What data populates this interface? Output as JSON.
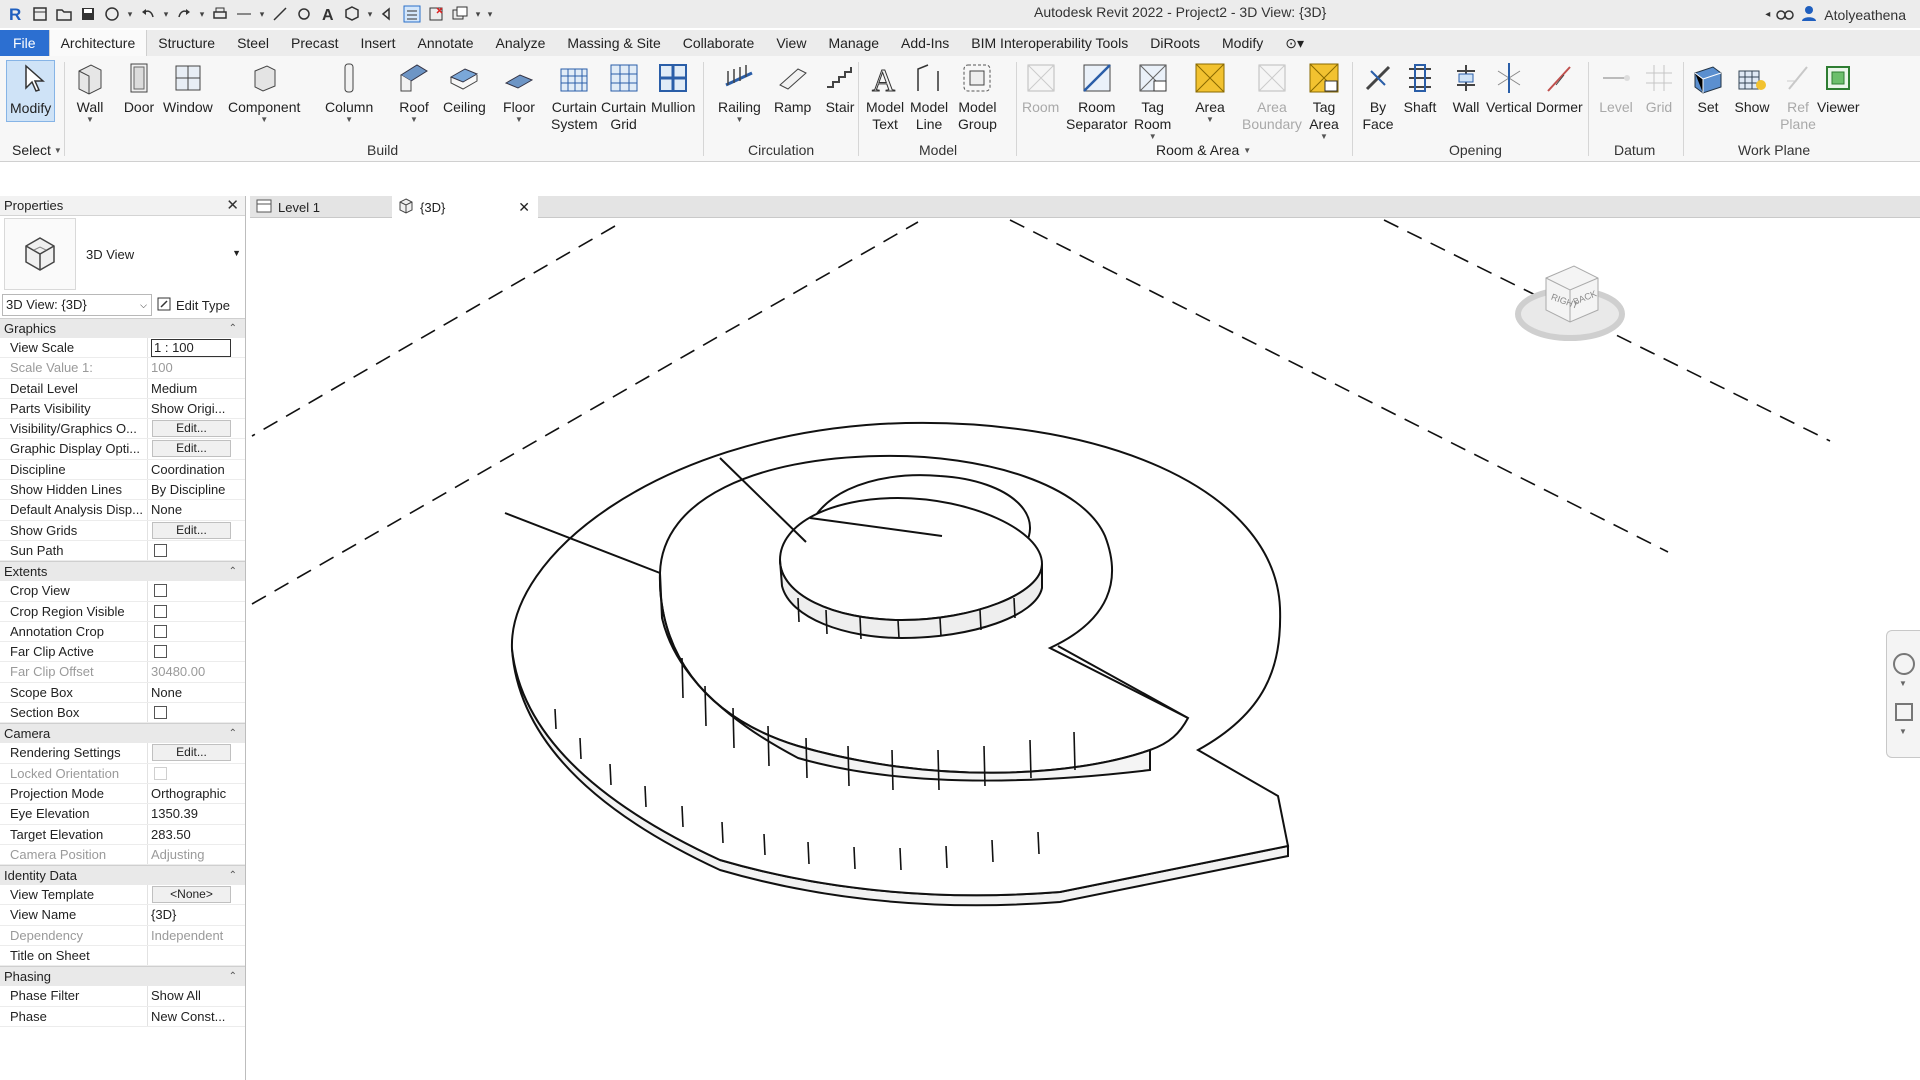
{
  "titlebar": {
    "title": "Autodesk Revit 2022 - Project2 - 3D View: {3D}",
    "user": "Atolyeathena",
    "app_icon": "R"
  },
  "menu": {
    "tabs": [
      "File",
      "Architecture",
      "Structure",
      "Steel",
      "Precast",
      "Insert",
      "Annotate",
      "Analyze",
      "Massing & Site",
      "Collaborate",
      "View",
      "Manage",
      "Add-Ins",
      "BIM Interoperability Tools",
      "DiRoots",
      "Modify"
    ],
    "active": "Architecture"
  },
  "ribbon": {
    "buttons": {
      "modify": "Modify",
      "wall": "Wall",
      "door": "Door",
      "window": "Window",
      "component": "Component",
      "column": "Column",
      "roof": "Roof",
      "ceiling": "Ceiling",
      "floor": "Floor",
      "curtain_system_1": "Curtain",
      "curtain_system_2": "System",
      "curtain_grid_1": "Curtain",
      "curtain_grid_2": "Grid",
      "mullion": "Mullion",
      "railing": "Railing",
      "ramp": "Ramp",
      "stair": "Stair",
      "model_text_1": "Model",
      "model_text_2": "Text",
      "model_line_1": "Model",
      "model_line_2": "Line",
      "model_group_1": "Model",
      "model_group_2": "Group",
      "room": "Room",
      "room_sep_1": "Room",
      "room_sep_2": "Separator",
      "tag_room_1": "Tag",
      "tag_room_2": "Room",
      "area": "Area",
      "area_boundary_1": "Area",
      "area_boundary_2": "Boundary",
      "tag_area_1": "Tag",
      "tag_area_2": "Area",
      "by_face_1": "By",
      "by_face_2": "Face",
      "shaft": "Shaft",
      "opening_wall": "Wall",
      "vertical": "Vertical",
      "dormer": "Dormer",
      "level": "Level",
      "grid": "Grid",
      "set": "Set",
      "show": "Show",
      "ref_plane_1": "Ref",
      "ref_plane_2": "Plane",
      "viewer": "Viewer"
    },
    "panels": {
      "select": "Select",
      "build": "Build",
      "circulation": "Circulation",
      "model": "Model",
      "room_area": "Room & Area",
      "opening": "Opening",
      "datum": "Datum",
      "work_plane": "Work Plane"
    }
  },
  "properties": {
    "header": "Properties",
    "type_name": "3D View",
    "instance": "3D View: {3D}",
    "edit_type": "Edit Type",
    "sections": {
      "graphics": "Graphics",
      "extents": "Extents",
      "camera": "Camera",
      "identity": "Identity Data",
      "phasing": "Phasing"
    },
    "rows": {
      "view_scale": {
        "name": "View Scale",
        "value": "1 : 100"
      },
      "scale_value": {
        "name": "Scale Value    1:",
        "value": "100"
      },
      "detail_level": {
        "name": "Detail Level",
        "value": "Medium"
      },
      "parts_visibility": {
        "name": "Parts Visibility",
        "value": "Show Origi..."
      },
      "vg_overrides": {
        "name": "Visibility/Graphics O...",
        "value": "Edit..."
      },
      "graphic_display": {
        "name": "Graphic Display Opti...",
        "value": "Edit..."
      },
      "discipline": {
        "name": "Discipline",
        "value": "Coordination"
      },
      "hidden_lines": {
        "name": "Show Hidden Lines",
        "value": "By Discipline"
      },
      "analysis_display": {
        "name": "Default Analysis Disp...",
        "value": "None"
      },
      "show_grids": {
        "name": "Show Grids",
        "value": "Edit..."
      },
      "sun_path": {
        "name": "Sun Path",
        "checked": false
      },
      "crop_view": {
        "name": "Crop View",
        "checked": false
      },
      "crop_region_visible": {
        "name": "Crop Region Visible",
        "checked": false
      },
      "annotation_crop": {
        "name": "Annotation Crop",
        "checked": false
      },
      "far_clip_active": {
        "name": "Far Clip Active",
        "checked": false
      },
      "far_clip_offset": {
        "name": "Far Clip Offset",
        "value": "30480.00"
      },
      "scope_box": {
        "name": "Scope Box",
        "value": "None"
      },
      "section_box": {
        "name": "Section Box",
        "checked": false
      },
      "rendering_settings": {
        "name": "Rendering Settings",
        "value": "Edit..."
      },
      "locked_orientation": {
        "name": "Locked Orientation",
        "checked": false
      },
      "projection_mode": {
        "name": "Projection Mode",
        "value": "Orthographic"
      },
      "eye_elevation": {
        "name": "Eye Elevation",
        "value": "1350.39"
      },
      "target_elevation": {
        "name": "Target Elevation",
        "value": "283.50"
      },
      "camera_position": {
        "name": "Camera Position",
        "value": "Adjusting"
      },
      "view_template": {
        "name": "View Template",
        "value": "<None>"
      },
      "view_name": {
        "name": "View Name",
        "value": "{3D}"
      },
      "dependency": {
        "name": "Dependency",
        "value": "Independent"
      },
      "title_on_sheet": {
        "name": "Title on Sheet",
        "value": ""
      },
      "phase_filter": {
        "name": "Phase Filter",
        "value": "Show All"
      },
      "phase": {
        "name": "Phase",
        "value": "New Const..."
      }
    }
  },
  "view_tabs": [
    {
      "label": "Level 1",
      "icon": "floor-plan-icon"
    },
    {
      "label": "{3D}",
      "icon": "3d-view-icon"
    }
  ],
  "viewcube": {
    "right": "RIGHT",
    "back": "BACK"
  },
  "colors": {
    "file_tab": "#2c6fd1",
    "selected_tool": "#cfe3f7",
    "ribbon_bg": "#f7f7f7"
  }
}
